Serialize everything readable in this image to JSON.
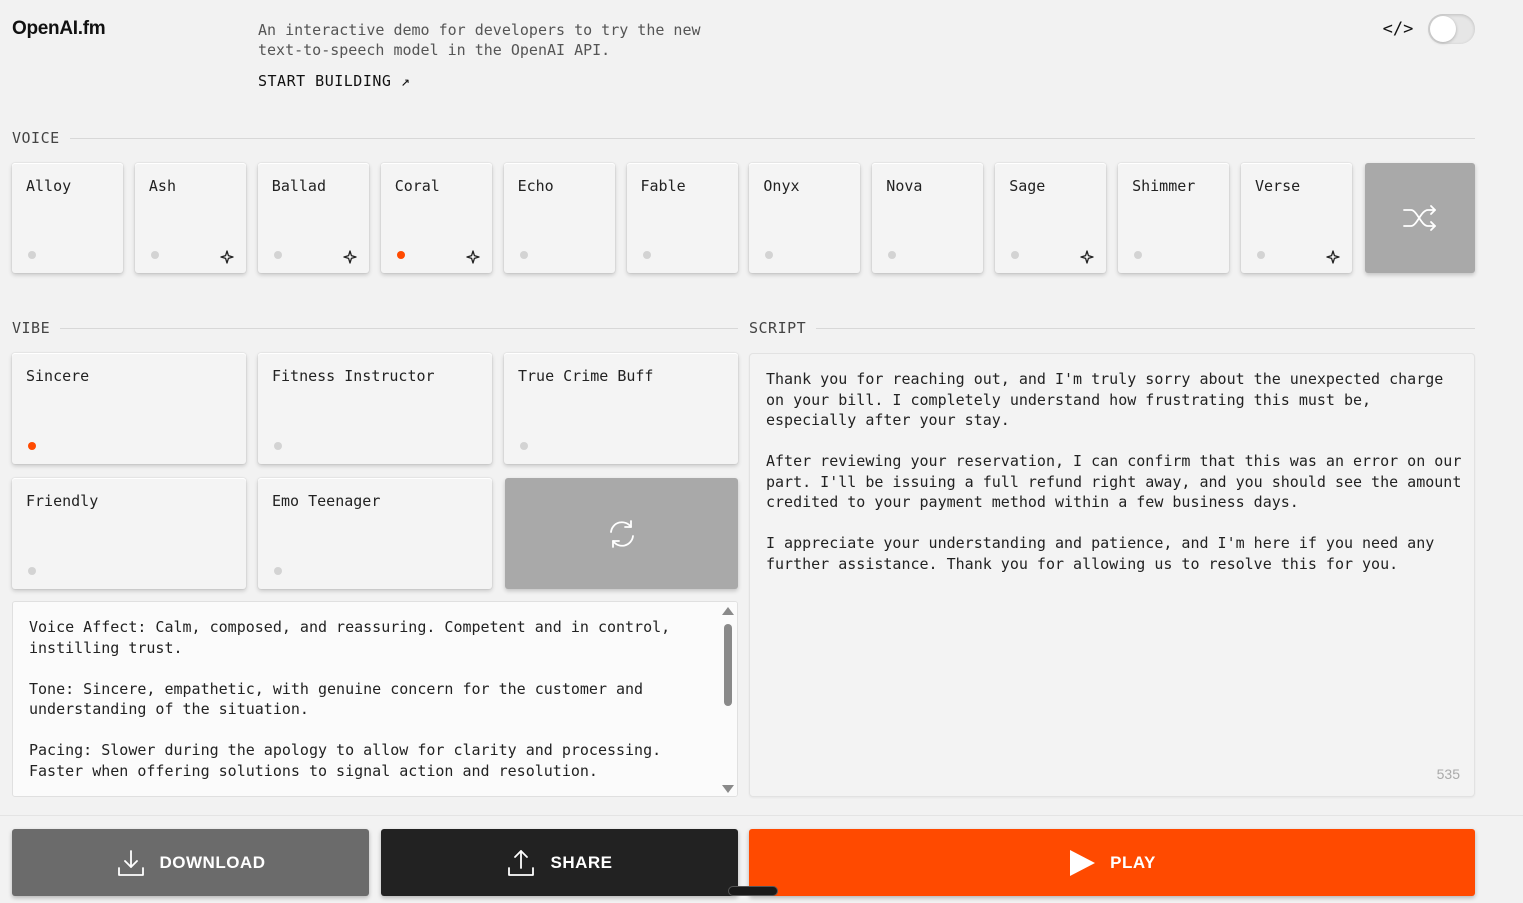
{
  "header": {
    "logo": "OpenAI.fm",
    "tagline": "An interactive demo for developers to try the new text-to-speech model in the OpenAI API.",
    "start_building": "START BUILDING ↗",
    "code_icon": "</>",
    "dev_mode_toggle": "off"
  },
  "voice": {
    "label": "VOICE",
    "selected": "Coral",
    "items": [
      {
        "name": "Alloy",
        "sparkle": false,
        "active": false
      },
      {
        "name": "Ash",
        "sparkle": true,
        "active": false
      },
      {
        "name": "Ballad",
        "sparkle": true,
        "active": false
      },
      {
        "name": "Coral",
        "sparkle": true,
        "active": true
      },
      {
        "name": "Echo",
        "sparkle": false,
        "active": false
      },
      {
        "name": "Fable",
        "sparkle": false,
        "active": false
      },
      {
        "name": "Onyx",
        "sparkle": false,
        "active": false
      },
      {
        "name": "Nova",
        "sparkle": false,
        "active": false
      },
      {
        "name": "Sage",
        "sparkle": true,
        "active": false
      },
      {
        "name": "Shimmer",
        "sparkle": false,
        "active": false
      },
      {
        "name": "Verse",
        "sparkle": true,
        "active": false
      }
    ],
    "shuffle_icon": "shuffle-icon"
  },
  "vibe": {
    "label": "VIBE",
    "selected": "Sincere",
    "items": [
      {
        "name": "Sincere",
        "active": true
      },
      {
        "name": "Fitness Instructor",
        "active": false
      },
      {
        "name": "True Crime Buff",
        "active": false
      },
      {
        "name": "Friendly",
        "active": false
      },
      {
        "name": "Emo Teenager",
        "active": false
      }
    ],
    "refresh_icon": "refresh-icon",
    "description": "Voice Affect: Calm, composed, and reassuring. Competent and in control, instilling trust.\n\nTone: Sincere, empathetic, with genuine concern for the customer and understanding of the situation.\n\nPacing: Slower during the apology to allow for clarity and processing. Faster when offering solutions to signal action and resolution."
  },
  "script": {
    "label": "SCRIPT",
    "text": "Thank you for reaching out, and I'm truly sorry about the unexpected charge on your bill. I completely understand how frustrating this must be, especially after your stay.\n\nAfter reviewing your reservation, I can confirm that this was an error on our part. I'll be issuing a full refund right away, and you should see the amount credited to your payment method within a few business days.\n\nI appreciate your understanding and patience, and I'm here if you need any further assistance. Thank you for allowing us to resolve this for you.",
    "char_count": "535"
  },
  "actions": {
    "download_label": "DOWNLOAD",
    "share_label": "SHARE",
    "play_label": "PLAY"
  },
  "colors": {
    "accent": "#ff4a00",
    "dark": "#222222",
    "gray_button": "#6b6b6b"
  }
}
